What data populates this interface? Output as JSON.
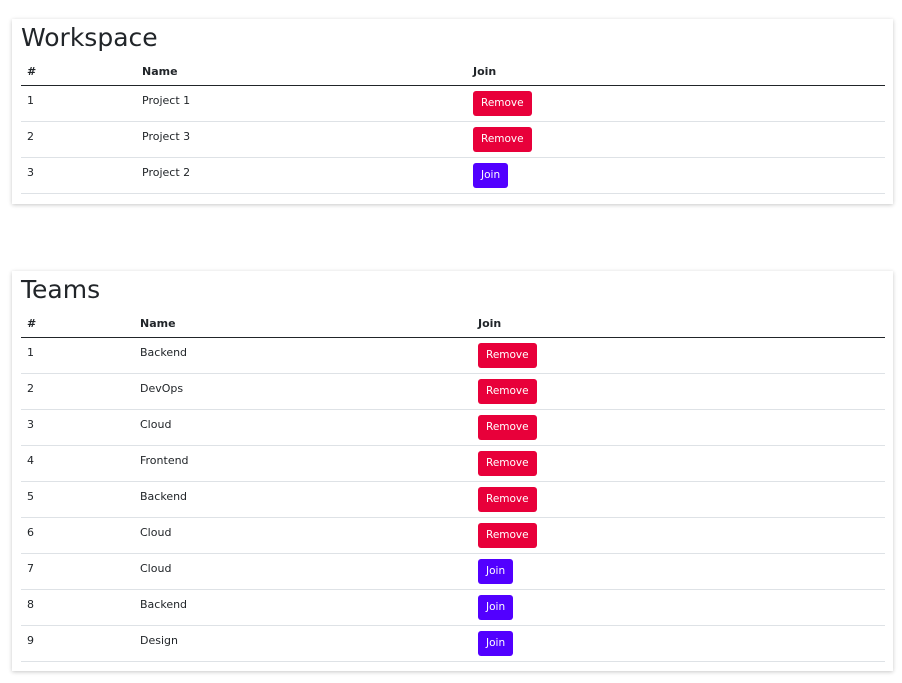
{
  "workspace": {
    "title": "Workspace",
    "headers": [
      "#",
      "Name",
      "Join"
    ],
    "rows": [
      {
        "num": "1",
        "name": "Project 1",
        "action": "Remove"
      },
      {
        "num": "2",
        "name": "Project 3",
        "action": "Remove"
      },
      {
        "num": "3",
        "name": "Project 2",
        "action": "Join"
      }
    ]
  },
  "teams": {
    "title": "Teams",
    "headers": [
      "#",
      "Name",
      "Join"
    ],
    "rows": [
      {
        "num": "1",
        "name": "Backend",
        "action": "Remove"
      },
      {
        "num": "2",
        "name": "DevOps",
        "action": "Remove"
      },
      {
        "num": "3",
        "name": "Cloud",
        "action": "Remove"
      },
      {
        "num": "4",
        "name": "Frontend",
        "action": "Remove"
      },
      {
        "num": "5",
        "name": "Backend",
        "action": "Remove"
      },
      {
        "num": "6",
        "name": "Cloud",
        "action": "Remove"
      },
      {
        "num": "7",
        "name": "Cloud",
        "action": "Join"
      },
      {
        "num": "8",
        "name": "Backend",
        "action": "Join"
      },
      {
        "num": "9",
        "name": "Design",
        "action": "Join"
      }
    ]
  },
  "colors": {
    "remove_button": "#e8003a",
    "join_button": "#5200ff"
  }
}
